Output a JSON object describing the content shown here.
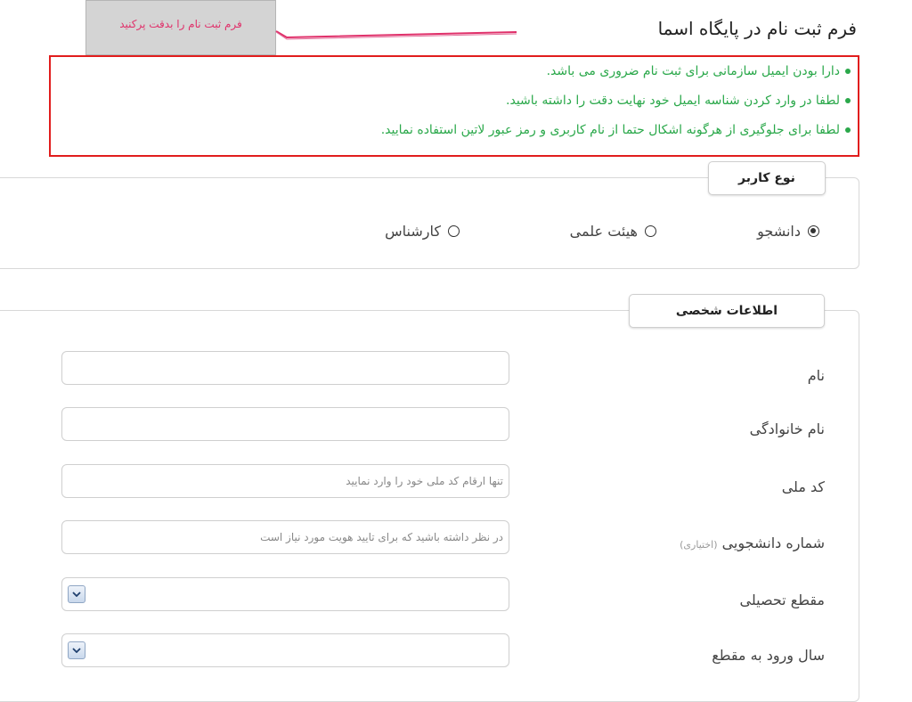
{
  "callout": {
    "text": "فرم ثبت نام را بدقت پرکنید"
  },
  "title": "فرم ثبت نام در پایگاه اسما",
  "notice": {
    "lines": [
      "دارا بودن ایمیل سازمانی برای ثبت نام ضروری می باشد.",
      "لطفا در وارد کردن شناسه ایمیل خود نهایت دقت را داشته باشید.",
      "لطفا برای جلوگیری از هرگونه اشکال حتما از نام کاربری و رمز عبور لاتین استفاده نمایید."
    ]
  },
  "user_type": {
    "legend": "نوع کاربر",
    "options": [
      "دانشجو",
      "هیئت علمی",
      "کارشناس"
    ],
    "selected": "دانشجو"
  },
  "personal": {
    "legend": "اطلاعات شخصی",
    "first_name": {
      "label": "نام",
      "value": ""
    },
    "last_name": {
      "label": "نام خانوادگی",
      "value": ""
    },
    "national_code": {
      "label": "کد ملی",
      "placeholder": "تنها ارقام کد ملی خود را وارد نمایید"
    },
    "student_number": {
      "label": "شماره دانشجویی",
      "optional": "(اختیاری)",
      "placeholder": "در نظر داشته باشید که برای تایید هویت مورد نیاز است"
    },
    "degree": {
      "label": "مقطع تحصیلی",
      "selected": ""
    },
    "entry_year": {
      "label": "سال ورود به مقطع",
      "selected": ""
    }
  },
  "colors": {
    "accent_pink": "#e0306a",
    "notice_green": "#2aa84a",
    "notice_border": "#e11d1d"
  },
  "icons": {
    "dropdown": "chevron-down-icon",
    "bullet": "bullet-dot-icon"
  }
}
